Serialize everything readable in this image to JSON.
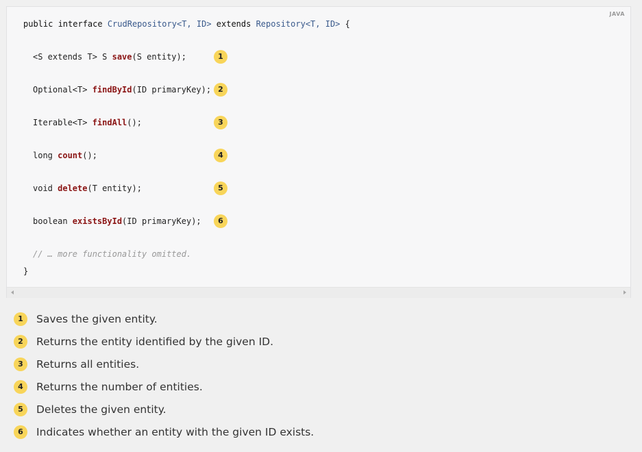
{
  "code_block": {
    "language_label": "JAVA",
    "lines": {
      "l1": {
        "kw1": "public interface ",
        "ty1": "CrudRepository<T, ID>",
        "kw2": " extends ",
        "ty2": "Repository<T, ID>",
        "rest": " {"
      },
      "l2": {
        "pre": "<S extends T> S ",
        "fn": "save",
        "post": "(S entity);"
      },
      "l3": {
        "pre": "Optional<T> ",
        "fn": "findById",
        "post": "(ID primaryKey);"
      },
      "l4": {
        "pre": "Iterable<T> ",
        "fn": "findAll",
        "post": "();"
      },
      "l5": {
        "pre": "long ",
        "fn": "count",
        "post": "();"
      },
      "l6": {
        "pre": "void ",
        "fn": "delete",
        "post": "(T entity);"
      },
      "l7": {
        "pre": "boolean ",
        "fn": "existsById",
        "post": "(ID primaryKey);"
      },
      "comment": "// … more functionality omitted.",
      "close": "}"
    },
    "badges": [
      "1",
      "2",
      "3",
      "4",
      "5",
      "6"
    ]
  },
  "callouts": [
    {
      "num": "1",
      "text": "Saves the given entity."
    },
    {
      "num": "2",
      "text": "Returns the entity identified by the given ID."
    },
    {
      "num": "3",
      "text": "Returns all entities."
    },
    {
      "num": "4",
      "text": "Returns the number of entities."
    },
    {
      "num": "5",
      "text": "Deletes the given entity."
    },
    {
      "num": "6",
      "text": "Indicates whether an entity with the given ID exists."
    }
  ],
  "colors": {
    "badge": "#f8d55a",
    "method_name": "#8b1515",
    "type_name": "#3a5a8c",
    "comment": "#999999"
  }
}
